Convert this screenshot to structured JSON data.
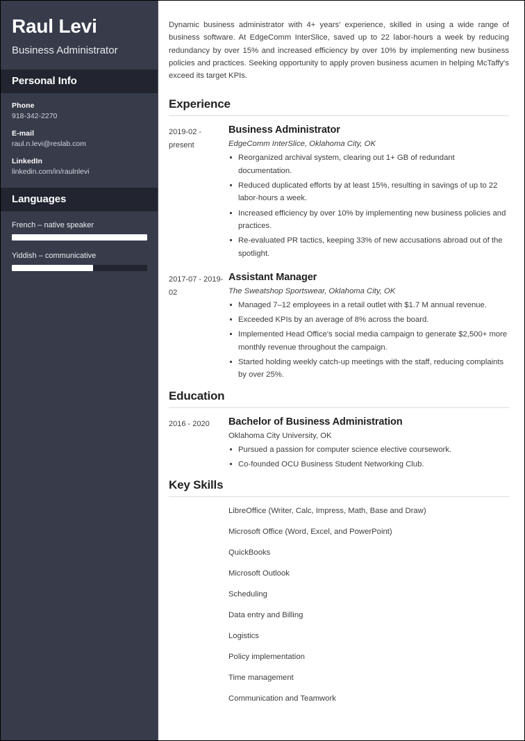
{
  "sidebar": {
    "full_name": "Raul Levi",
    "job_title": "Business Administrator",
    "personal_info": {
      "heading": "Personal Info",
      "fields": [
        {
          "label": "Phone",
          "value": "918-342-2270"
        },
        {
          "label": "E-mail",
          "value": "raul.n.levi@reslab.com"
        },
        {
          "label": "LinkedIn",
          "value": "linkedin.com/in/raulnlevi"
        }
      ]
    },
    "languages": {
      "heading": "Languages",
      "items": [
        {
          "name": "French – native speaker",
          "level_percent": 100
        },
        {
          "name": "Yiddish – communicative",
          "level_percent": 60
        }
      ]
    },
    "colors": {
      "background": "#373b4a",
      "band": "#22242f",
      "text": "#ffffff",
      "bar_fill": "#ffffff"
    }
  },
  "main": {
    "summary": "Dynamic business administrator with 4+ years' experience, skilled in using a wide range of business software. At EdgeComm InterSlice, saved up to 22 labor-hours a week by reducing redundancy by over 15% and increased efficiency by over 10% by implementing new business policies and practices. Seeking opportunity to apply proven business acumen in helping McTaffy's exceed its target KPIs.",
    "experience": {
      "heading": "Experience",
      "entries": [
        {
          "dates": "2019-02 - present",
          "role": "Business Administrator",
          "organization": "EdgeComm InterSlice, Oklahoma City, OK",
          "bullets": [
            "Reorganized archival system, clearing out 1+ GB of redundant documentation.",
            "Reduced duplicated efforts by at least 15%, resulting in savings of up to 22 labor-hours a week.",
            "Increased efficiency by over 10% by implementing new business policies and practices.",
            "Re-evaluated PR tactics, keeping 33% of new accusations abroad out of the spotlight."
          ]
        },
        {
          "dates": "2017-07 - 2019-02",
          "role": "Assistant Manager",
          "organization": "The Sweatshop Sportswear, Oklahoma City, OK",
          "bullets": [
            "Managed 7–12 employees in a retail outlet with $1.7 M annual revenue.",
            "Exceeded KPIs by an average of 8% across the board.",
            "Implemented Head Office's social media campaign to generate $2,500+ more monthly revenue throughout the campaign.",
            "Started holding weekly catch-up meetings with the staff, reducing complaints by over 25%."
          ]
        }
      ]
    },
    "education": {
      "heading": "Education",
      "entries": [
        {
          "dates": "2016 - 2020",
          "degree": "Bachelor of Business Administration",
          "institution": "Oklahoma City University, OK",
          "bullets": [
            "Pursued a passion for computer science elective coursework.",
            "Co-founded OCU Business Student Networking Club."
          ]
        }
      ]
    },
    "key_skills": {
      "heading": "Key Skills",
      "items": [
        "LibreOffice (Writer, Calc, Impress, Math, Base and Draw)",
        "Microsoft Office (Word, Excel, and PowerPoint)",
        "QuickBooks",
        "Microsoft Outlook",
        "Scheduling",
        "Data entry and Billing",
        "Logistics",
        "Policy implementation",
        "Time management",
        "Communication and Teamwork"
      ]
    }
  }
}
